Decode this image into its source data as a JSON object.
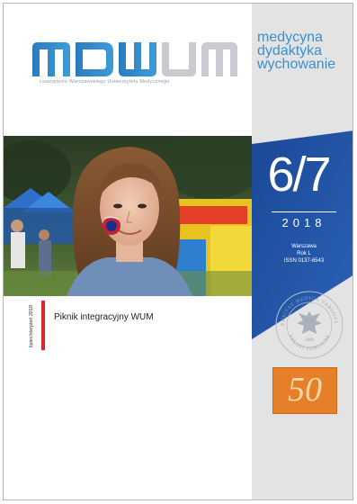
{
  "journal": {
    "logo_text": "MDWUM",
    "subtitle": "czasopismo Warszawskiego Uniwersytetu Medycznego",
    "tagline": [
      "medycyna",
      "dydaktyka",
      "wychowanie"
    ]
  },
  "issue": {
    "number": "6/7",
    "year": "2018",
    "city": "Warszawa",
    "volume": "Rok L",
    "issn": "ISSN 0137-6543",
    "date_vertical": "lipiec/sierpień 2018"
  },
  "cover_story": {
    "headline": "Piknik integracyjny WUM"
  },
  "seal": {
    "top_text": "UNIVERSITAS MEDICA VARSOVIENSIS",
    "bottom_text": "SALUTI PUBLICAE",
    "year": "1809"
  },
  "badge": {
    "value": "50"
  },
  "colors": {
    "brand_blue": "#3a8fcd",
    "banner_blue": "#1f4e9c",
    "accent_red": "#d8282e",
    "badge_orange": "#e67f29",
    "sidebar_gray": "#e3e3e3"
  }
}
